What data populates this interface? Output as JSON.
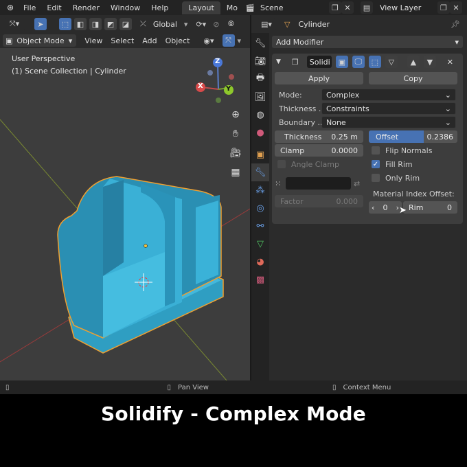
{
  "topbar": {
    "menus": [
      "File",
      "Edit",
      "Render",
      "Window",
      "Help"
    ],
    "workspace_tabs": [
      {
        "label": "Layout",
        "active": true
      },
      {
        "label": "Mo",
        "active": false
      }
    ],
    "scene": "Scene",
    "view_layer": "View Layer"
  },
  "viewport": {
    "transform_orientation": "Global",
    "mode": "Object Mode",
    "menus": [
      "View",
      "Select",
      "Add",
      "Object"
    ],
    "info_line1": "User Perspective",
    "info_line2": "(1) Scene Collection | Cylinder",
    "gizmo": {
      "z": "Z",
      "y": "Y",
      "x": "X"
    }
  },
  "properties": {
    "object_name": "Cylinder",
    "add_modifier": "Add Modifier",
    "modifier_name": "Solidi",
    "apply_label": "Apply",
    "copy_label": "Copy",
    "mode_label": "Mode:",
    "mode_value": "Complex",
    "thickness_mode_label": "Thickness ...",
    "thickness_mode_value": "Constraints",
    "boundary_label": "Boundary ...",
    "boundary_value": "None",
    "thickness_label": "Thickness",
    "thickness_value": "0.25 m",
    "offset_label": "Offset",
    "offset_value": "0.2386",
    "offset_fraction": 0.62,
    "clamp_label": "Clamp",
    "clamp_value": "0.0000",
    "flip_normals_label": "Flip Normals",
    "flip_normals": false,
    "angle_clamp_label": "Angle Clamp",
    "fill_rim_label": "Fill Rim",
    "fill_rim": true,
    "only_rim_label": "Only Rim",
    "only_rim": false,
    "factor_label": "Factor",
    "factor_value": "0.000",
    "material_index_label": "Material Index Offset:",
    "material_index_value": "0",
    "rim_label": "Rim",
    "rim_value": "0"
  },
  "statusbar": {
    "pan_view": "Pan View",
    "context_menu": "Context Menu"
  },
  "caption": "Solidify - Complex Mode",
  "colors": {
    "accent": "#4772b3",
    "mesh": "#3aaed0",
    "outline": "#f0a030"
  }
}
